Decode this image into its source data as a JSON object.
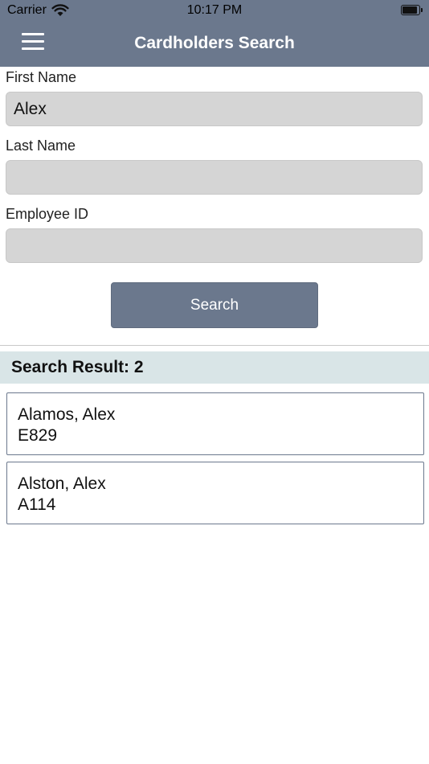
{
  "status_bar": {
    "carrier": "Carrier",
    "time": "10:17 PM",
    "wifi_icon": "wifi-icon",
    "battery_icon": "battery-icon"
  },
  "nav": {
    "title": "Cardholders Search",
    "menu_icon": "hamburger-menu-icon",
    "background_color": "#6b788d"
  },
  "form": {
    "first_name_label": "First Name",
    "first_name_value": "Alex",
    "last_name_label": "Last Name",
    "last_name_value": "",
    "employee_id_label": "Employee ID",
    "employee_id_value": "",
    "search_label": "Search"
  },
  "results": {
    "header": "Search Result: 2",
    "items": [
      {
        "name": "Alamos, Alex",
        "id": "E829"
      },
      {
        "name": "Alston, Alex",
        "id": "A114"
      }
    ]
  }
}
